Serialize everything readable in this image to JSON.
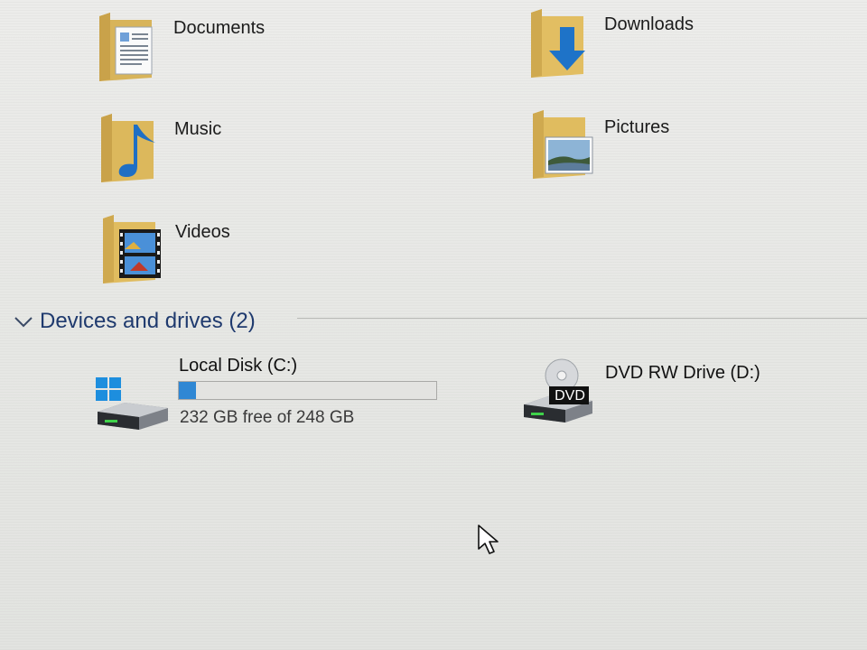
{
  "folders": [
    {
      "label": "Documents"
    },
    {
      "label": "Downloads"
    },
    {
      "label": "Music"
    },
    {
      "label": "Pictures"
    },
    {
      "label": "Videos"
    }
  ],
  "devices": {
    "header": "Devices and drives (2)",
    "drives": [
      {
        "name": "Local Disk (C:)",
        "free_text": "232 GB free of 248 GB",
        "used_fraction": 0.065
      },
      {
        "name": "DVD RW Drive (D:)",
        "badge": "DVD"
      }
    ]
  },
  "colors": {
    "folder": "#e9c46a",
    "accent": "#2f87d4",
    "header_text": "#1f3a6e"
  }
}
